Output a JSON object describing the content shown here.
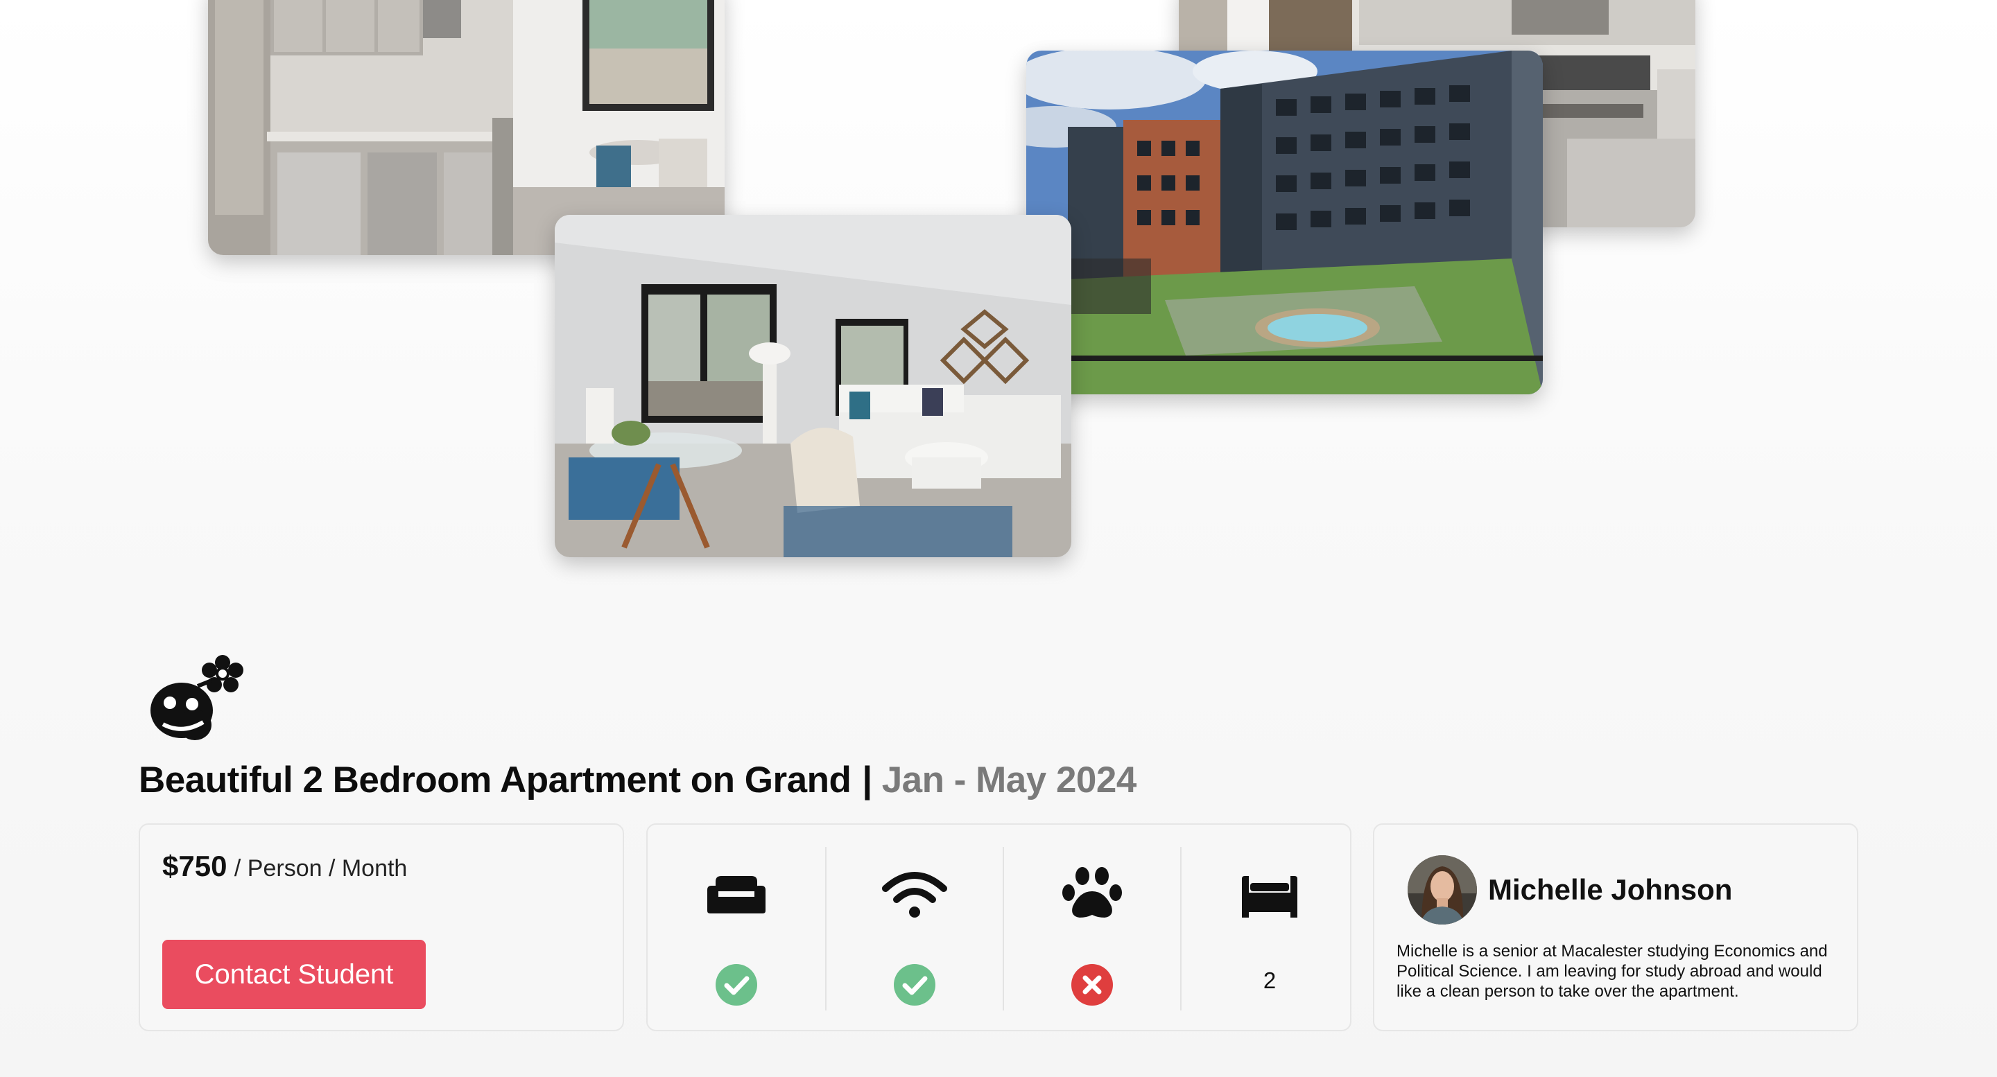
{
  "listing": {
    "title": "Beautiful 2 Bedroom Apartment on Grand",
    "separator": "|",
    "dates": "Jan - May 2024"
  },
  "photos": [
    {
      "name": "kitchen-photo-1",
      "icon": "photo"
    },
    {
      "name": "kitchen-photo-2",
      "icon": "photo"
    },
    {
      "name": "building-courtyard-photo",
      "icon": "photo"
    },
    {
      "name": "living-room-photo",
      "icon": "photo"
    }
  ],
  "price": {
    "amount": "$750",
    "unit": "/ Person / Month"
  },
  "contact_button": "Contact Student",
  "amenities": [
    {
      "name": "furnished",
      "icon": "couch-icon",
      "status": "check"
    },
    {
      "name": "wifi",
      "icon": "wifi-icon",
      "status": "check"
    },
    {
      "name": "pets",
      "icon": "paw-icon",
      "status": "cross"
    },
    {
      "name": "beds",
      "icon": "bed-icon",
      "count": "2"
    }
  ],
  "owner": {
    "name": "Michelle Johnson",
    "bio": "Michelle is a senior at Macalester studying Economics and Political Science. I am leaving for study abroad and would like a clean person to take over the apartment."
  },
  "colors": {
    "accent": "#ea4c5f",
    "check": "#6cc08b",
    "cross": "#df3e3e",
    "muted_text": "#7a7a7a"
  }
}
